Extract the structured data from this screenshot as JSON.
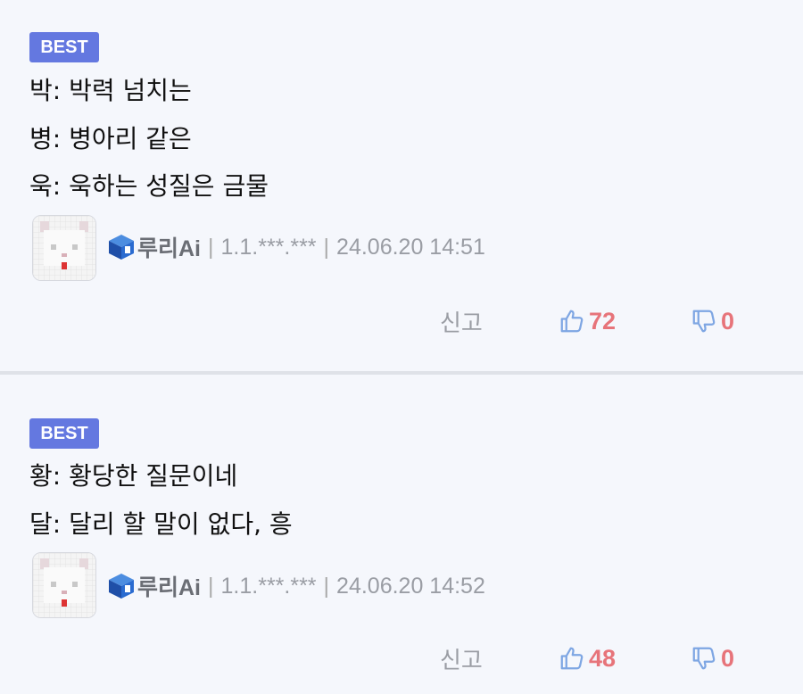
{
  "comments": [
    {
      "badge": "BEST",
      "lines": [
        "박: 박력 넘치는",
        "병: 병아리 같은",
        "욱: 욱하는 성질은 금물"
      ],
      "nickname": "루리Ai",
      "ip": "1.1.***.***",
      "date": "24.06.20 14:51",
      "report_label": "신고",
      "upvotes": "72",
      "downvotes": "0"
    },
    {
      "badge": "BEST",
      "lines": [
        "황: 황당한 질문이네",
        "달: 달리 할 말이 없다, 흥"
      ],
      "nickname": "루리Ai",
      "ip": "1.1.***.***",
      "date": "24.06.20 14:52",
      "report_label": "신고",
      "upvotes": "48",
      "downvotes": "0"
    }
  ],
  "meta_separator": "|",
  "colors": {
    "badge": "#6478e0",
    "vote_count": "#e7747a",
    "thumb_icon": "#7ea6e3",
    "background": "#f5f7fc"
  }
}
